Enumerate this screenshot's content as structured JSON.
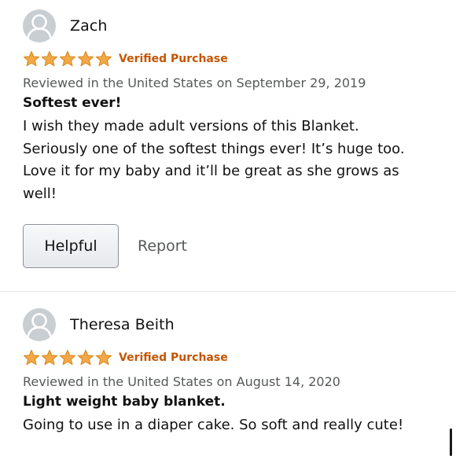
{
  "reviews": [
    {
      "reviewer": "Zach",
      "rating": 5,
      "rating_max": 5,
      "verified_label": "Verified Purchase",
      "date_line": "Reviewed in the United States on September 29, 2019",
      "title": "Softest ever!",
      "body": "I wish they made adult versions of this Blanket.\nSeriously one of the softest things ever! It’s huge too.\nLove it for my baby and it’ll be great as she grows as\nwell!",
      "helpful_label": "Helpful",
      "report_label": "Report"
    },
    {
      "reviewer": "Theresa Beith",
      "rating": 5,
      "rating_max": 5,
      "verified_label": "Verified Purchase",
      "date_line": "Reviewed in the United States on August 14, 2020",
      "title": "Light weight baby blanket.",
      "body": "Going to use in a diaper cake. So soft and really cute!"
    }
  ],
  "colors": {
    "star": "#f3a847",
    "star_outline": "#d88b1e",
    "verified": "#c45500",
    "meta_text": "#565959",
    "avatar_bg": "#c9ced3",
    "avatar_fg": "#ffffff"
  },
  "icons": {
    "avatar": "default-profile-icon",
    "star": "star-icon"
  }
}
